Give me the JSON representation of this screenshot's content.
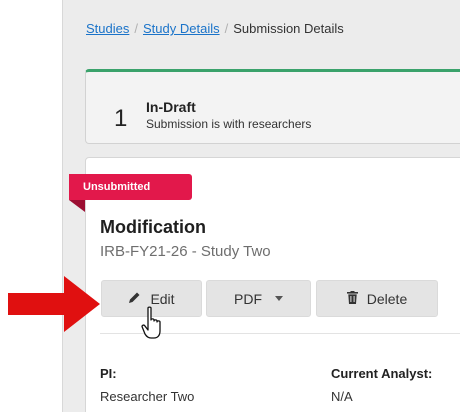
{
  "breadcrumb": {
    "studies": "Studies",
    "separator": "/",
    "study_details": "Study Details",
    "current": "Submission Details"
  },
  "status": {
    "number": "1",
    "title": "In-Draft",
    "subtitle": "Submission is with researchers",
    "accent_color": "#3aa26b"
  },
  "submission": {
    "badge": "Unsubmitted",
    "badge_color": "#e2184b",
    "title": "Modification",
    "subtitle": "IRB-FY21-26 - Study Two"
  },
  "actions": {
    "edit_label": "Edit",
    "pdf_label": "PDF",
    "delete_label": "Delete"
  },
  "details": {
    "pi_label": "PI:",
    "pi_value": "Researcher Two",
    "analyst_label": "Current Analyst:",
    "analyst_value": "N/A"
  },
  "annotation": {
    "arrow_color": "#e01010",
    "arrow_icon": "right-arrow-icon",
    "cursor_icon": "hand-pointer-icon"
  }
}
